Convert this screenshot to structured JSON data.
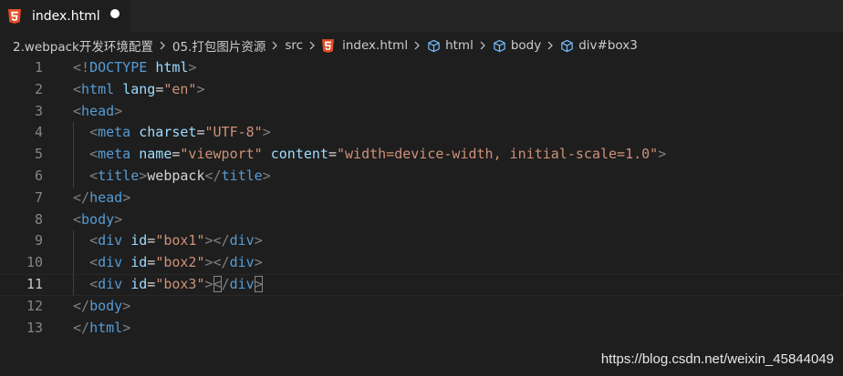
{
  "tab": {
    "title": "index.html",
    "icon": "html5-icon",
    "unsaved": true
  },
  "breadcrumb": [
    {
      "label": "2.webpack开发环境配置",
      "icon": null
    },
    {
      "label": "05.打包图片资源",
      "icon": null
    },
    {
      "label": "src",
      "icon": null
    },
    {
      "label": "index.html",
      "icon": "html5-icon"
    },
    {
      "label": "html",
      "icon": "element-cube-icon"
    },
    {
      "label": "body",
      "icon": "element-cube-icon"
    },
    {
      "label": "div#box3",
      "icon": "element-cube-icon"
    }
  ],
  "editor": {
    "current_line": 11,
    "lines": [
      {
        "n": "1",
        "tokens": [
          [
            "punc",
            "<!"
          ],
          [
            "tag",
            "DOCTYPE"
          ],
          [
            "text",
            " "
          ],
          [
            "attr",
            "html"
          ],
          [
            "punc",
            ">"
          ]
        ]
      },
      {
        "n": "2",
        "tokens": [
          [
            "punc",
            "<"
          ],
          [
            "tag",
            "html"
          ],
          [
            "text",
            " "
          ],
          [
            "attr",
            "lang"
          ],
          [
            "text",
            "="
          ],
          [
            "str",
            "\"en\""
          ],
          [
            "punc",
            ">"
          ]
        ]
      },
      {
        "n": "3",
        "tokens": [
          [
            "punc",
            "<"
          ],
          [
            "tag",
            "head"
          ],
          [
            "punc",
            ">"
          ]
        ]
      },
      {
        "n": "4",
        "tokens": [
          [
            "text",
            "  "
          ],
          [
            "punc",
            "<"
          ],
          [
            "tag",
            "meta"
          ],
          [
            "text",
            " "
          ],
          [
            "attr",
            "charset"
          ],
          [
            "text",
            "="
          ],
          [
            "str",
            "\"UTF-8\""
          ],
          [
            "punc",
            ">"
          ]
        ]
      },
      {
        "n": "5",
        "tokens": [
          [
            "text",
            "  "
          ],
          [
            "punc",
            "<"
          ],
          [
            "tag",
            "meta"
          ],
          [
            "text",
            " "
          ],
          [
            "attr",
            "name"
          ],
          [
            "text",
            "="
          ],
          [
            "str",
            "\"viewport\""
          ],
          [
            "text",
            " "
          ],
          [
            "attr",
            "content"
          ],
          [
            "text",
            "="
          ],
          [
            "str",
            "\"width=device-width, initial-scale=1.0\""
          ],
          [
            "punc",
            ">"
          ]
        ]
      },
      {
        "n": "6",
        "tokens": [
          [
            "text",
            "  "
          ],
          [
            "punc",
            "<"
          ],
          [
            "tag",
            "title"
          ],
          [
            "punc",
            ">"
          ],
          [
            "text",
            "webpack"
          ],
          [
            "punc",
            "</"
          ],
          [
            "tag",
            "title"
          ],
          [
            "punc",
            ">"
          ]
        ]
      },
      {
        "n": "7",
        "tokens": [
          [
            "punc",
            "</"
          ],
          [
            "tag",
            "head"
          ],
          [
            "punc",
            ">"
          ]
        ]
      },
      {
        "n": "8",
        "tokens": [
          [
            "punc",
            "<"
          ],
          [
            "tag",
            "body"
          ],
          [
            "punc",
            ">"
          ]
        ]
      },
      {
        "n": "9",
        "tokens": [
          [
            "text",
            "  "
          ],
          [
            "punc",
            "<"
          ],
          [
            "tag",
            "div"
          ],
          [
            "text",
            " "
          ],
          [
            "attr",
            "id"
          ],
          [
            "text",
            "="
          ],
          [
            "str",
            "\"box1\""
          ],
          [
            "punc",
            "></"
          ],
          [
            "tag",
            "div"
          ],
          [
            "punc",
            ">"
          ]
        ]
      },
      {
        "n": "10",
        "tokens": [
          [
            "text",
            "  "
          ],
          [
            "punc",
            "<"
          ],
          [
            "tag",
            "div"
          ],
          [
            "text",
            " "
          ],
          [
            "attr",
            "id"
          ],
          [
            "text",
            "="
          ],
          [
            "str",
            "\"box2\""
          ],
          [
            "punc",
            "></"
          ],
          [
            "tag",
            "div"
          ],
          [
            "punc",
            ">"
          ]
        ]
      },
      {
        "n": "11",
        "tokens": [
          [
            "text",
            "  "
          ],
          [
            "punc",
            "<"
          ],
          [
            "tag",
            "div"
          ],
          [
            "text",
            " "
          ],
          [
            "attr",
            "id"
          ],
          [
            "text",
            "="
          ],
          [
            "str",
            "\"box3\""
          ],
          [
            "punc",
            ">"
          ],
          [
            "match",
            "<"
          ],
          [
            "punc",
            "/"
          ],
          [
            "tag",
            "div"
          ],
          [
            "match",
            ">"
          ]
        ]
      },
      {
        "n": "12",
        "tokens": [
          [
            "punc",
            "</"
          ],
          [
            "tag",
            "body"
          ],
          [
            "punc",
            ">"
          ]
        ]
      },
      {
        "n": "13",
        "tokens": [
          [
            "punc",
            "</"
          ],
          [
            "tag",
            "html"
          ],
          [
            "punc",
            ">"
          ]
        ]
      }
    ]
  },
  "watermark": "https://blog.csdn.net/weixin_45844049",
  "colors": {
    "background": "#1e1e1e",
    "tabbar": "#252526",
    "html5_orange": "#e44d26",
    "tag_blue": "#569cd6",
    "attr_lightblue": "#9cdcfe",
    "string_orange": "#ce9178",
    "punctuation_gray": "#808080",
    "line_number": "#858585",
    "cube_icon_blue": "#75beff"
  }
}
